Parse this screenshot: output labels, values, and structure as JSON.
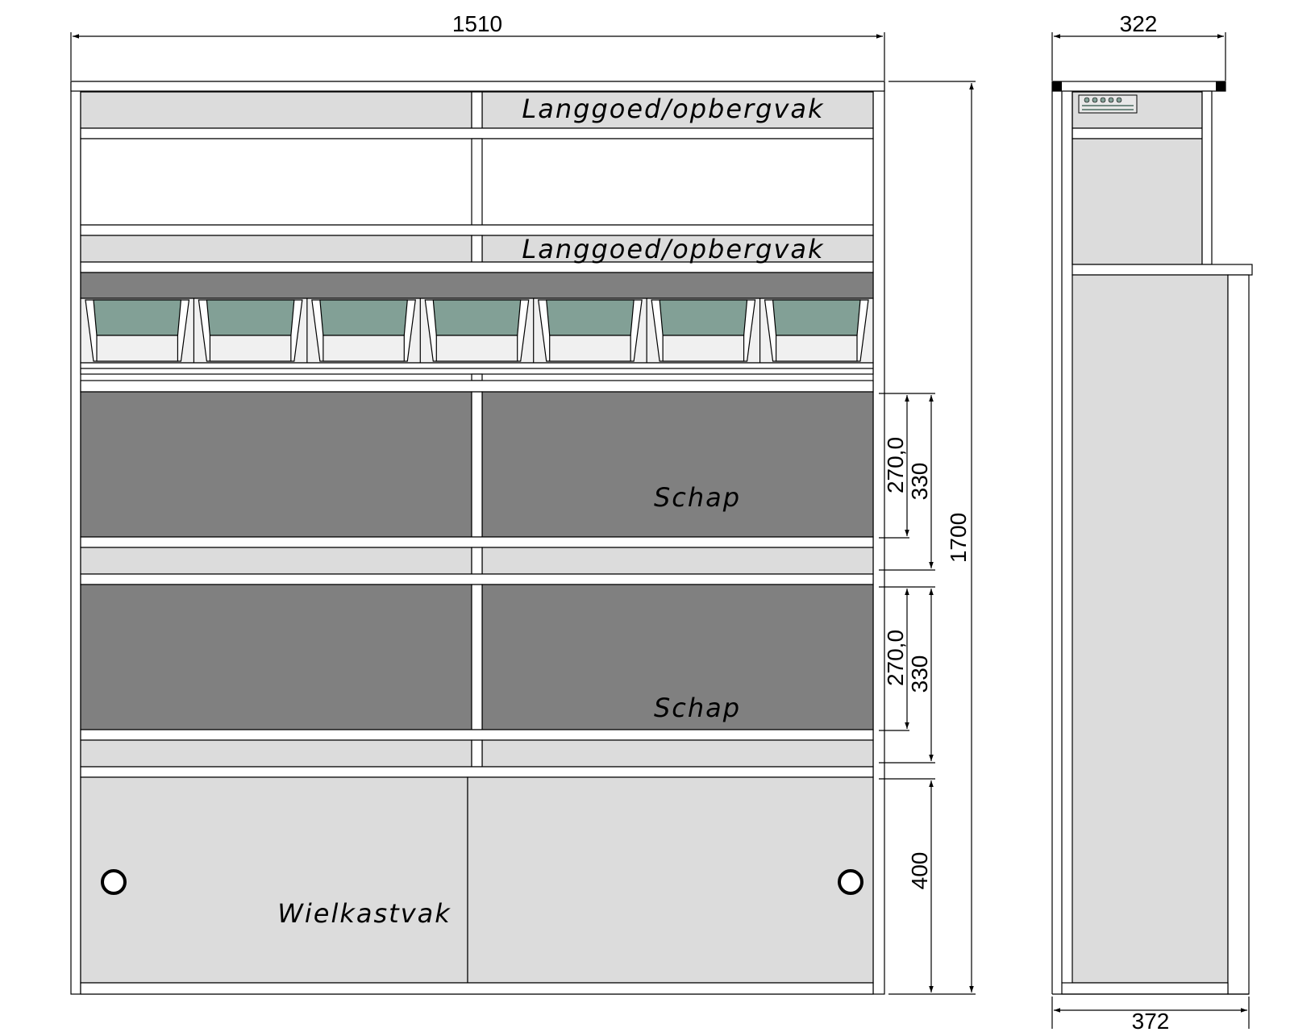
{
  "dimensions": {
    "front_width": "1510",
    "side_top_depth": "322",
    "side_bottom_depth": "372",
    "total_height": "1700",
    "shelf_upper_inner": "270,0",
    "shelf_upper_outer": "330",
    "shelf_lower_inner": "270,0",
    "shelf_lower_outer": "330",
    "wheel_box_height": "400"
  },
  "labels": {
    "long_goods_top": "Langgoed/opbergvak",
    "long_goods_mid": "Langgoed/opbergvak",
    "shelf_upper": "Schap",
    "shelf_lower": "Schap",
    "wheel_box": "Wielkastvak"
  },
  "bins": {
    "count": 7,
    "color": "#82a096"
  },
  "colors": {
    "light_panel": "#dcdcdc",
    "dark_panel": "#808080",
    "bin_tray": "#f0f0f0",
    "line": "#000000"
  }
}
